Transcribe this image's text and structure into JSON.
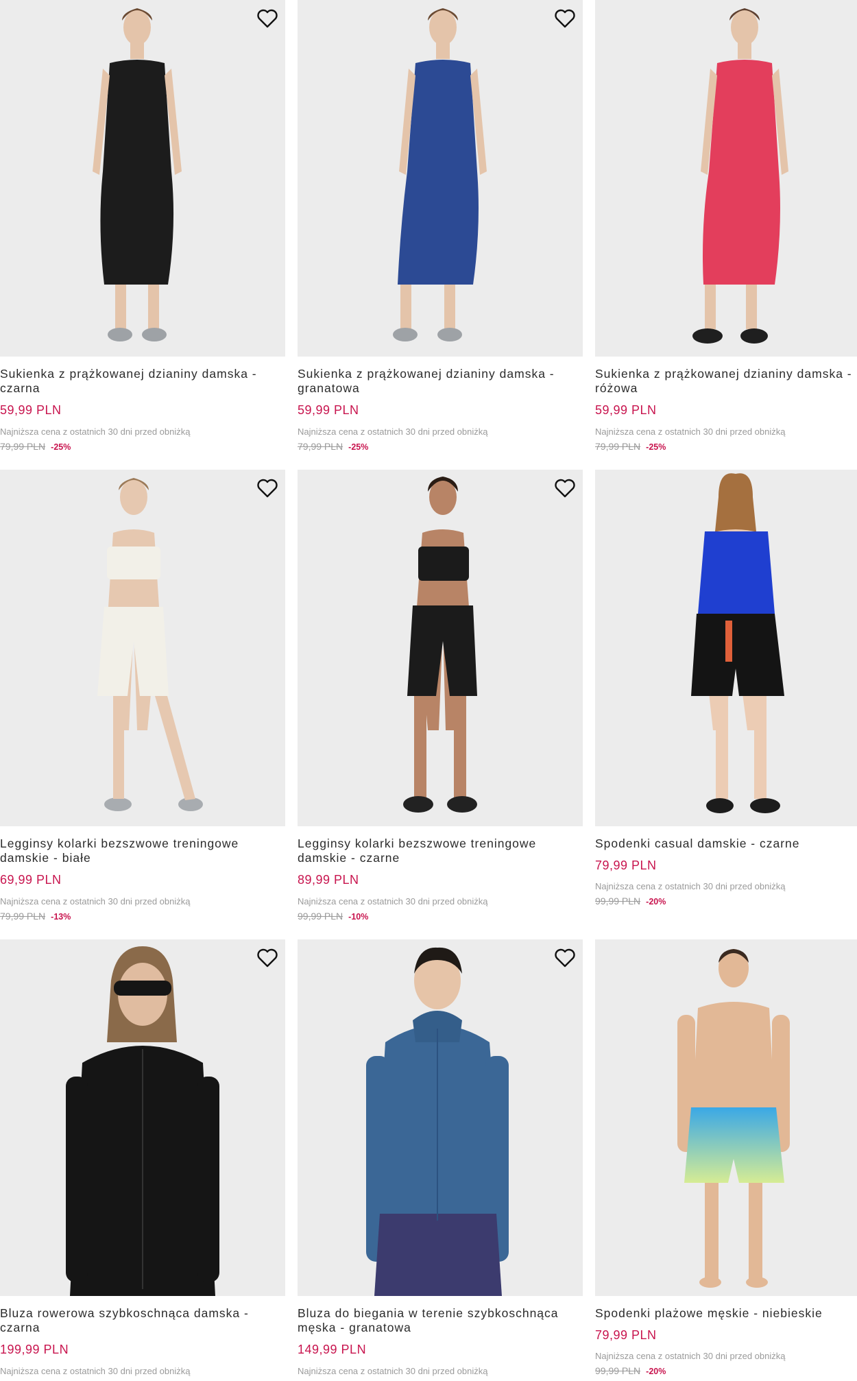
{
  "products": [
    {
      "name": "Sukienka z prążkowanej dzianiny damska - czarna",
      "price": "59,99 PLN",
      "lowest_label": "Najniższa cena z ostatnich 30 dni przed obniżką",
      "old_price": "79,99 PLN",
      "discount": "-25%",
      "icon": "heart-outline-icon",
      "colors": {
        "garment": "#1c1c1c",
        "skin": "#e4c4aa",
        "hair": "#6b4a32",
        "shoes": "#9ea2a6"
      }
    },
    {
      "name": "Sukienka z prążkowanej dzianiny damska - granatowa",
      "price": "59,99 PLN",
      "lowest_label": "Najniższa cena z ostatnich 30 dni przed obniżką",
      "old_price": "79,99 PLN",
      "discount": "-25%",
      "icon": "heart-outline-icon",
      "colors": {
        "garment": "#2c4a94",
        "skin": "#e4c4aa",
        "hair": "#6b4a32",
        "shoes": "#9ea2a6"
      }
    },
    {
      "name": "Sukienka z prążkowanej dzianiny damska - różowa",
      "price": "59,99 PLN",
      "lowest_label": "Najniższa cena z ostatnich 30 dni przed obniżką",
      "old_price": "79,99 PLN",
      "discount": "-25%",
      "icon": "heart-outline-icon",
      "colors": {
        "garment": "#e33e5c",
        "skin": "#e4c4aa",
        "hair": "#5e4030",
        "shoes": "#1f1f1f"
      }
    },
    {
      "name": "Legginsy kolarki bezszwowe treningowe damskie - białe",
      "price": "69,99 PLN",
      "lowest_label": "Najniższa cena z ostatnich 30 dni przed obniżką",
      "old_price": "79,99 PLN",
      "discount": "-13%",
      "icon": "heart-outline-icon",
      "colors": {
        "top": "#f2f0e8",
        "bottom": "#f2f0e8",
        "skin": "#e6c8b0",
        "hair": "#9c7a58",
        "shoes": "#a8acb0"
      }
    },
    {
      "name": "Legginsy kolarki bezszwowe treningowe damskie - czarne",
      "price": "89,99 PLN",
      "lowest_label": "Najniższa cena z ostatnich 30 dni przed obniżką",
      "old_price": "99,99 PLN",
      "discount": "-10%",
      "icon": "heart-outline-icon",
      "colors": {
        "top": "#1b1b1b",
        "bottom": "#1b1b1b",
        "skin": "#b88466",
        "hair": "#2a1c14",
        "shoes": "#222222"
      }
    },
    {
      "name": "Spodenki casual damskie - czarne",
      "price": "79,99 PLN",
      "lowest_label": "Najniższa cena z ostatnich 30 dni przed obniżką",
      "old_price": "99,99 PLN",
      "discount": "-20%",
      "icon": "heart-outline-icon",
      "colors": {
        "top": "#1f3fd0",
        "bottom": "#141414",
        "skin": "#ecccb4",
        "hair": "#a5703f",
        "shoes": "#1c1c1c"
      }
    },
    {
      "name": "Bluza rowerowa szybkoschnąca damska - czarna",
      "price": "199,99 PLN",
      "lowest_label": "Najniższa cena z ostatnich 30 dni przed obniżką",
      "icon": "heart-outline-icon",
      "colors": {
        "top": "#151515",
        "bottom": "#151515",
        "skin": "#e0bca0",
        "hair": "#8a6a4a"
      }
    },
    {
      "name": "Bluza do biegania w terenie szybkoschnąca męska - granatowa",
      "price": "149,99 PLN",
      "lowest_label": "Najniższa cena z ostatnich 30 dni przed obniżką",
      "icon": "heart-outline-icon",
      "colors": {
        "top": "#3b6796",
        "bottom": "#3c3b6e",
        "skin": "#e6c4a8",
        "hair": "#1f1a16"
      }
    },
    {
      "name": "Spodenki plażowe męskie - niebieskie",
      "price": "79,99 PLN",
      "lowest_label": "Najniższa cena z ostatnich 30 dni przed obniżką",
      "old_price": "99,99 PLN",
      "discount": "-20%",
      "icon": "heart-outline-icon",
      "colors": {
        "top": "#e2b896",
        "bottom": "#3aa8e6",
        "bottom2": "#d6ec94",
        "skin": "#e2b896",
        "hair": "#3a2a20"
      }
    }
  ]
}
